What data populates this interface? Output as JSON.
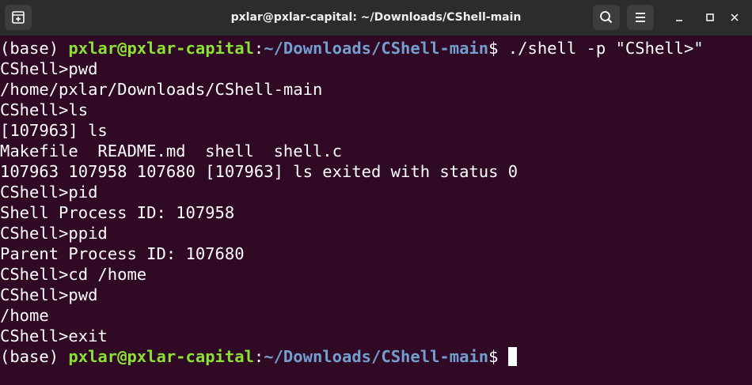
{
  "window": {
    "title": "pxlar@pxlar-capital: ~/Downloads/CShell-main",
    "icons": [
      "new-tab-icon",
      "search-icon",
      "hamburger-menu-icon",
      "minimize-icon",
      "maximize-icon",
      "close-icon"
    ]
  },
  "colors": {
    "background": "#300a24",
    "titlebar": "#2c2c2c",
    "user_host": "#8ae234",
    "path": "#729fcf",
    "text": "#ffffff"
  },
  "prompt": {
    "env": "(base) ",
    "user_host": "pxlar@pxlar-capital",
    "colon": ":",
    "path": "~/Downloads/CShell-main",
    "dollar": "$ "
  },
  "first_command": "./shell -p \"CShell>\"",
  "lines": [
    "CShell>pwd",
    "/home/pxlar/Downloads/CShell-main",
    "CShell>ls",
    "[107963] ls",
    "Makefile  README.md  shell  shell.c",
    "107963 107958 107680 [107963] ls exited with status 0",
    "CShell>pid",
    "Shell Process ID: 107958",
    "CShell>ppid",
    "Parent Process ID: 107680",
    "CShell>cd /home",
    "CShell>pwd",
    "/home",
    "CShell>exit"
  ]
}
